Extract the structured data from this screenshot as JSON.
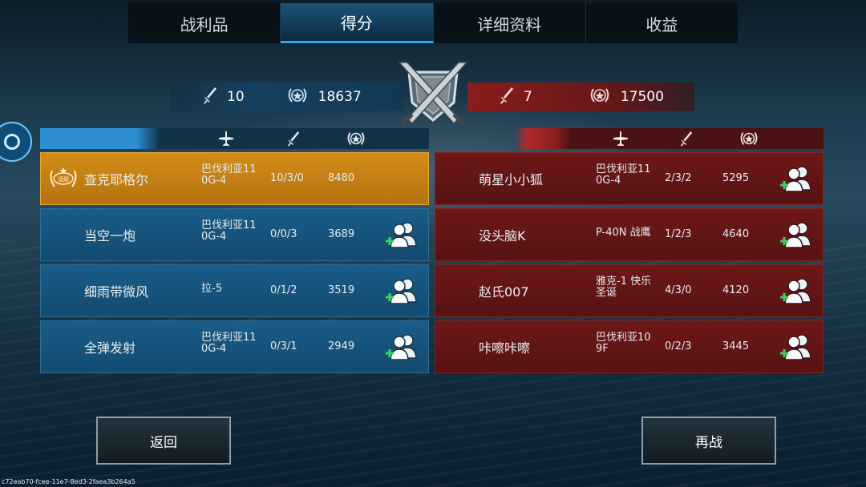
{
  "tabs": [
    {
      "label": "战利品"
    },
    {
      "label": "得分"
    },
    {
      "label": "详细资料"
    },
    {
      "label": "收益"
    }
  ],
  "active_tab": "得分",
  "blue_team": {
    "kills": "10",
    "score": "18637",
    "players": [
      {
        "name": "查克耶格尔",
        "plane": "巴伐利亚11 0G-4",
        "kda": "10/3/0",
        "points": "8480",
        "medal": "话题",
        "is_self": true
      },
      {
        "name": "当空一炮",
        "plane": "巴伐利亚11 0G-4",
        "kda": "0/0/3",
        "points": "3689"
      },
      {
        "name": "细雨带微风",
        "plane": "拉-5",
        "kda": "0/1/2",
        "points": "3519"
      },
      {
        "name": "全弹发射",
        "plane": "巴伐利亚11 0G-4",
        "kda": "0/3/1",
        "points": "2949"
      }
    ]
  },
  "red_team": {
    "kills": "7",
    "score": "17500",
    "players": [
      {
        "name": "萌星小小狐",
        "plane": "巴伐利亚11 0G-4",
        "kda": "2/3/2",
        "points": "5295"
      },
      {
        "name": "没头脑K",
        "plane": "P-40N 战鹰",
        "kda": "1/2/3",
        "points": "4640"
      },
      {
        "name": "赵氏007",
        "plane": "雅克-1 快乐圣诞",
        "kda": "4/3/0",
        "points": "4120"
      },
      {
        "name": "咔嚓咔嚓",
        "plane": "巴伐利亚10 9F",
        "kda": "0/2/3",
        "points": "3445"
      }
    ]
  },
  "buttons": {
    "back": "返回",
    "rematch": "再战"
  },
  "build_id": "c72eab70-fcee-11e7-8ed3-2faea3b264a5",
  "colors": {
    "blue_team": "#16405f",
    "red_team": "#8a1d1d",
    "highlight": "#d28c17",
    "active_tab": "#2ea7f0"
  },
  "icons": {
    "kills": "sword-icon",
    "score": "laurel-star-icon",
    "plane": "plane-icon",
    "add_friend": "add-friend-icon",
    "emblem": "crossed-swords-shield-icon"
  }
}
